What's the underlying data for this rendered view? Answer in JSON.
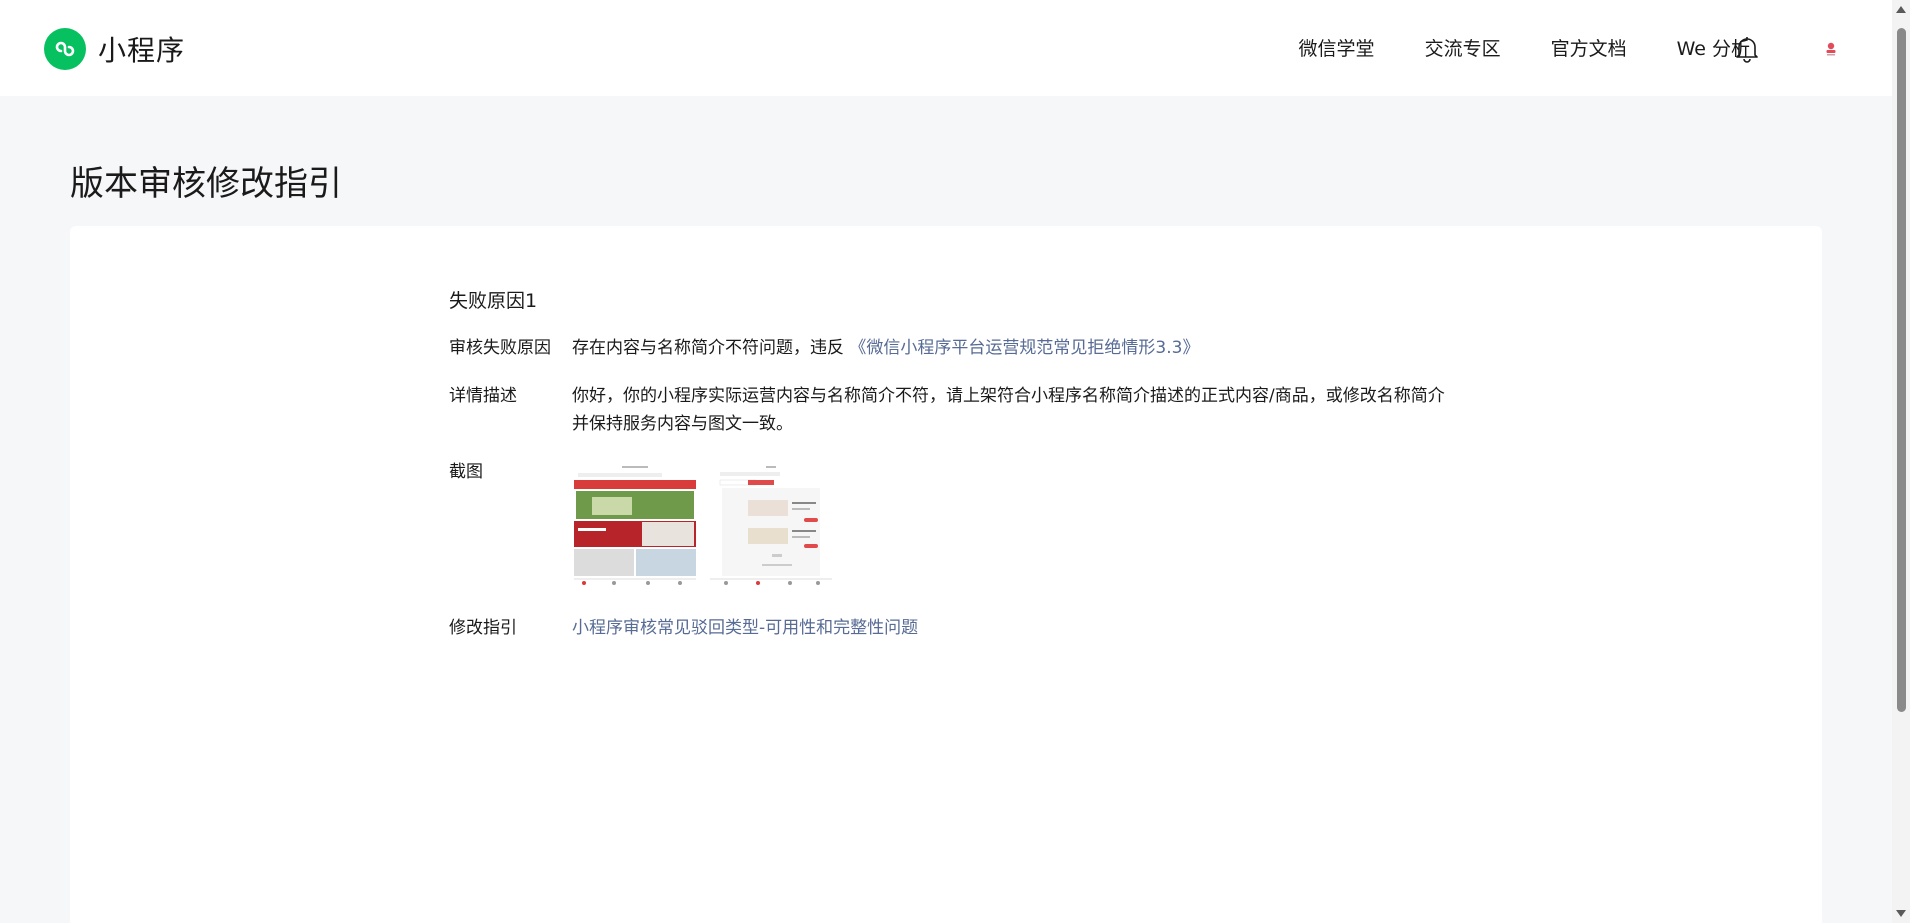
{
  "header": {
    "logo_text": "小程序",
    "nav": [
      "微信学堂",
      "交流专区",
      "官方文档",
      "We 分析"
    ],
    "colors": {
      "brand": "#07c160",
      "link": "#576b95"
    }
  },
  "page": {
    "title": "版本审核修改指引"
  },
  "review": {
    "section_title": "失败原因1",
    "reason_label": "审核失败原因",
    "reason_text": "存在内容与名称简介不符问题，违反",
    "reason_link": "《微信小程序平台运营规范常见拒绝情形3.3》",
    "detail_label": "详情描述",
    "detail_text": "你好，你的小程序实际运营内容与名称简介不符，请上架符合小程序名称简介描述的正式内容/商品，或修改名称简介并保持服务内容与图文一致。",
    "screenshot_label": "截图",
    "guide_label": "修改指引",
    "guide_link": "小程序审核常见驳回类型-可用性和完整性问题"
  }
}
